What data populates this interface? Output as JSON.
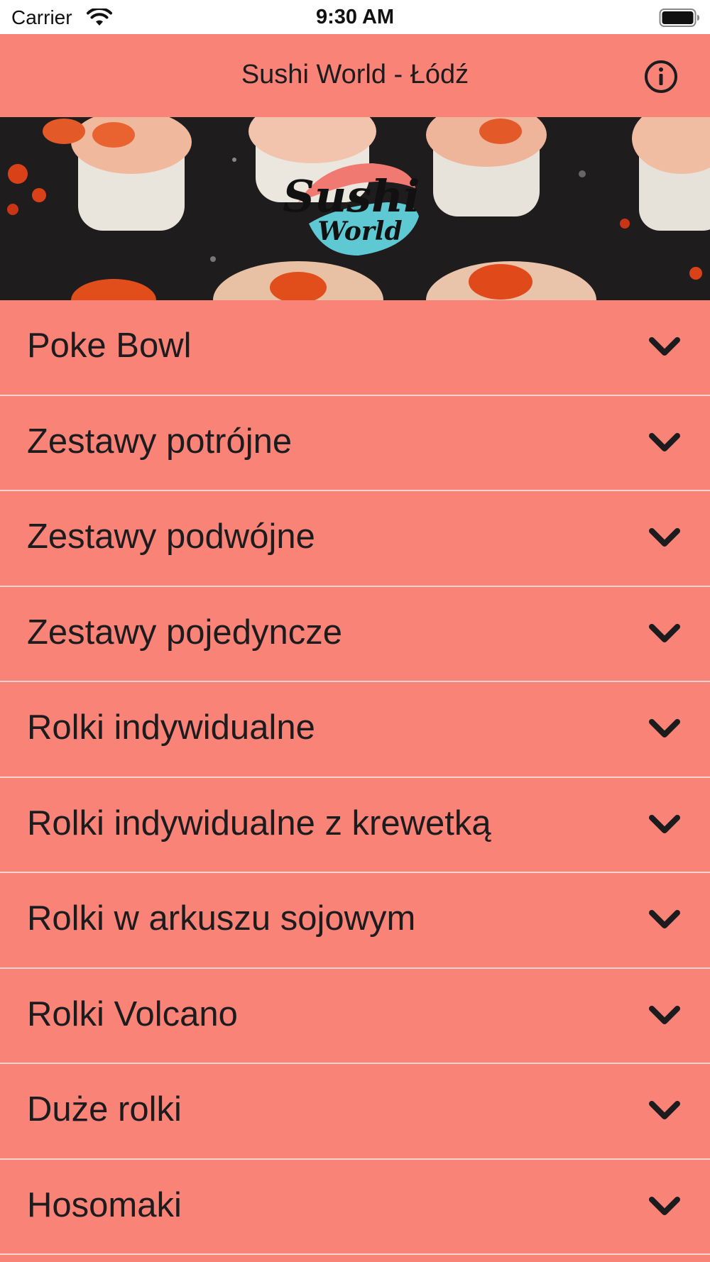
{
  "status_bar": {
    "carrier": "Carrier",
    "time": "9:30 AM",
    "icons": [
      "wifi-icon",
      "battery-icon"
    ]
  },
  "nav_bar": {
    "title": "Sushi World - Łódź",
    "info_icon": "info-icon"
  },
  "hero": {
    "logo_line1": "Sushi",
    "logo_line2": "World"
  },
  "menu": {
    "chevron_icon": "chevron-down-icon",
    "items": [
      {
        "label": "Poke Bowl"
      },
      {
        "label": "Zestawy potrójne"
      },
      {
        "label": "Zestawy podwójne"
      },
      {
        "label": "Zestawy pojedyncze"
      },
      {
        "label": "Rolki indywidualne"
      },
      {
        "label": "Rolki indywidualne z krewetką"
      },
      {
        "label": "Rolki w arkuszu sojowym"
      },
      {
        "label": "Rolki Volcano"
      },
      {
        "label": "Duże rolki"
      },
      {
        "label": "Hosomaki"
      }
    ]
  },
  "colors": {
    "accent": "#FA8377",
    "text": "#1C1C1E",
    "divider": "#F4D2CF"
  }
}
